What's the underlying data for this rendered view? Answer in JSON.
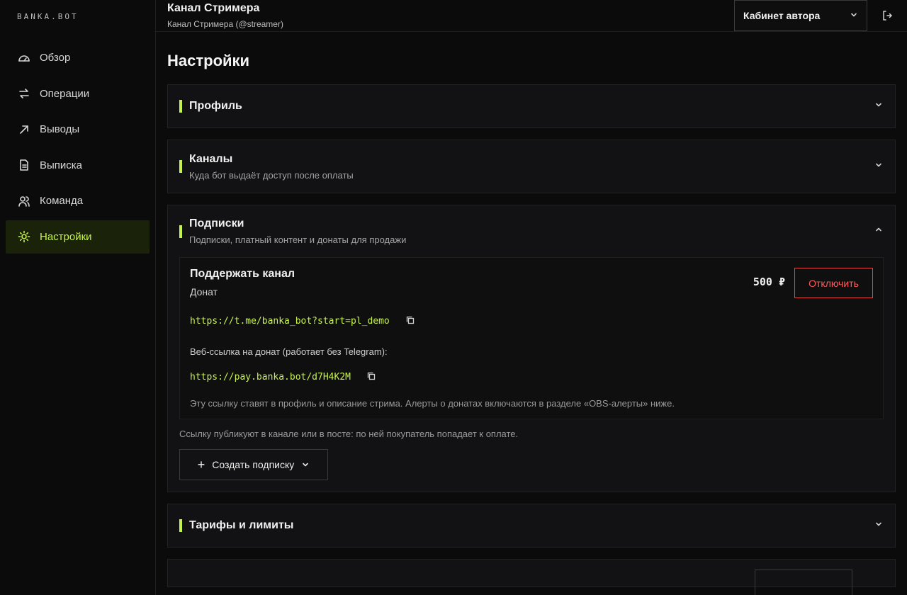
{
  "app": {
    "logo": "BANKA.BOT"
  },
  "sidebar": {
    "items": [
      {
        "label": "Обзор",
        "icon": "gauge-icon",
        "active": false
      },
      {
        "label": "Операции",
        "icon": "arrows-swap-icon",
        "active": false
      },
      {
        "label": "Выводы",
        "icon": "arrow-up-right-icon",
        "active": false
      },
      {
        "label": "Выписка",
        "icon": "document-icon",
        "active": false
      },
      {
        "label": "Команда",
        "icon": "users-icon",
        "active": false
      },
      {
        "label": "Настройки",
        "icon": "gear-icon",
        "active": true
      }
    ]
  },
  "header": {
    "title": "Канал Стримера",
    "subtitle": "Канал Стримера (@streamer)",
    "cabinet_label": "Кабинет автора"
  },
  "page": {
    "title": "Настройки"
  },
  "sections": {
    "profile": {
      "name": "Профиль"
    },
    "channels": {
      "name": "Каналы",
      "desc": "Куда бот выдаёт доступ после оплаты"
    },
    "subscriptions": {
      "name": "Подписки",
      "desc": "Подписки, платный контент и донаты для продажи",
      "plan": {
        "name": "Поддержать канал",
        "type": "Донат",
        "price": "500 ₽",
        "disable_label": "Отключить",
        "bot_link": "https://t.me/banka_bot?start=pl_demo",
        "web_label": "Веб-ссылка на донат (работает без Telegram):",
        "web_link": "https://pay.banka.bot/d7H4K2M",
        "hint": "Эту ссылку ставят в профиль и описание стрима. Алерты о донатах включаются в разделе «OBS-алерты» ниже."
      },
      "note": "Ссылку публикуют в канале или в посте: по ней покупатель попадает к оплате.",
      "create_label": "Создать подписку"
    },
    "tariffs": {
      "name": "Тарифы и лимиты"
    }
  },
  "colors": {
    "accent": "#c6f24e",
    "danger": "#e04848",
    "background": "#0b0b0c"
  }
}
